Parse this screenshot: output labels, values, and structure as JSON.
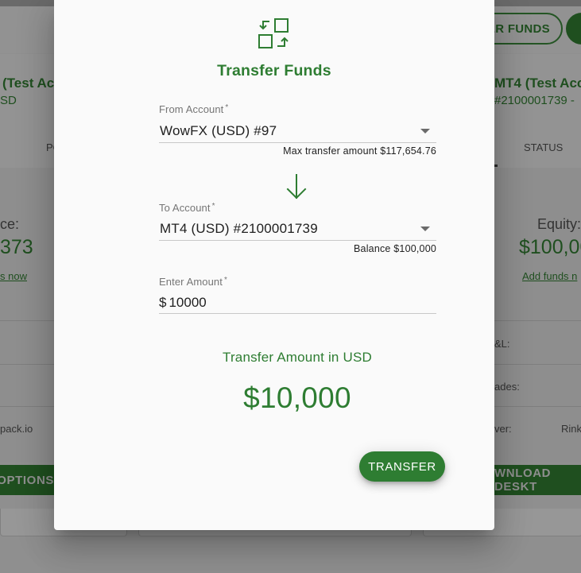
{
  "background": {
    "header_button_label": "ER FUNDS",
    "left_account_title": "(Test Acco",
    "left_account_sub": "SD",
    "right_account_title": "MT4 (Test Acco",
    "right_account_sub": "#2100001739 -",
    "left_tab": "PO",
    "right_tab": "STATUS",
    "left_metric_label": "ce:",
    "left_metric_value": "373",
    "left_link": "s now",
    "right_metric_label": "Equity:",
    "right_metric_value": "$100,00",
    "right_link": "Add funds n",
    "row_pl": "&L:",
    "row_trades": "ades:",
    "row_left_text": "pack.io",
    "row_server": "ver:",
    "row_server_value": "Rink",
    "left_bar_label": "OPTIONS",
    "right_bar_label": "WNLOAD DESKT"
  },
  "modal": {
    "icon": "transfer-swap-icon",
    "title": "Transfer Funds",
    "from_label": "From Account",
    "from_required": "*",
    "from_value": "WowFX (USD) #97",
    "from_helper": "Max transfer amount $117,654.76",
    "arrow_icon": "arrow-down-icon",
    "to_label": "To Account",
    "to_required": "*",
    "to_value": "MT4 (USD) #2100001739",
    "to_helper": "Balance $100,000",
    "amount_label": "Enter Amount",
    "amount_required": "*",
    "amount_prefix": "$",
    "amount_value": "10000",
    "amount_caption": "Transfer Amount in USD",
    "amount_display": "$10,000",
    "transfer_button": "TRANSFER"
  },
  "colors": {
    "accent": "#2e7d32",
    "backdrop": "#8f8f8f",
    "modal_bg": "#fafafa"
  }
}
